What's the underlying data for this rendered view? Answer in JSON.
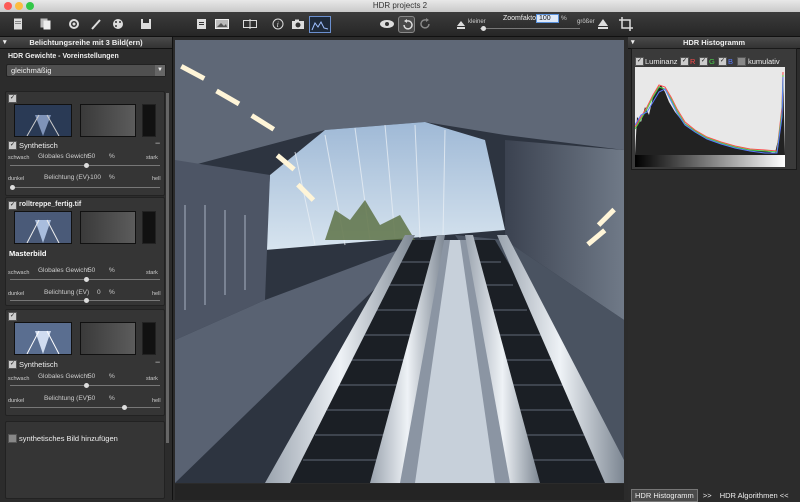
{
  "window": {
    "title": "HDR projects 2"
  },
  "toolbar": {
    "zoom_label": "Zoomfaktor",
    "zoom_value": "100",
    "zoom_unit": "%",
    "smaller_label": "kleiner",
    "larger_label": "größer",
    "histogram_label": "HDR"
  },
  "left_panel": {
    "header": "Belichtungsreihe mit 3 Bild(ern)",
    "weights_title": "HDR Gewichte - Voreinstellungen",
    "weights_preset": "gleichmäßig",
    "image1": {
      "label": "Synthetisch",
      "weak": "schwach",
      "strong": "stark",
      "weight_label": "Globales Gewicht",
      "weight_value": "50",
      "weight_unit": "%",
      "dark": "dunkel",
      "bright": "hell",
      "exposure_label": "Belichtung (EV)",
      "exposure_value": "-100",
      "exposure_unit": "%"
    },
    "image2": {
      "filename": "rolltreppe_fertig.tif",
      "weak": "schwach",
      "strong": "stark",
      "weight_label": "Globales Gewicht",
      "weight_value": "50",
      "weight_unit": "%",
      "master_label": "Masterbild",
      "dark": "dunkel",
      "bright": "hell",
      "exposure_label": "Belichtung (EV)",
      "exposure_value": "0",
      "exposure_unit": "%"
    },
    "image3": {
      "label": "Synthetisch",
      "weak": "schwach",
      "strong": "stark",
      "weight_label": "Globales Gewicht",
      "weight_value": "50",
      "weight_unit": "%",
      "dark": "dunkel",
      "bright": "hell",
      "exposure_label": "Belichtung (EV)",
      "exposure_value": "50",
      "exposure_unit": "%"
    },
    "add_synthetic": "synthetisches Bild hinzufügen"
  },
  "right_panel": {
    "header": "HDR Histogramm",
    "luminance": "Luminanz",
    "r": "R",
    "g": "G",
    "b": "B",
    "cumulative": "kumulativ"
  },
  "bottom_tabs": {
    "active": "HDR Histogramm",
    "separator": ">>",
    "other": "HDR Algorithmen <<"
  },
  "colors": {
    "accent_blue": "#3b73c8",
    "panel": "#2c2c2c",
    "highlight": "#5a92dd"
  },
  "icons": [
    "document-icon",
    "copy-icon",
    "settings-icon",
    "brush-icon",
    "palette-icon",
    "save-icon",
    "export-icon",
    "image-icon",
    "compare-icon",
    "info-icon",
    "camera-exif-icon",
    "histogram-icon",
    "eye-icon",
    "rotate-left-icon",
    "rotate-right-icon",
    "crop-icon"
  ]
}
